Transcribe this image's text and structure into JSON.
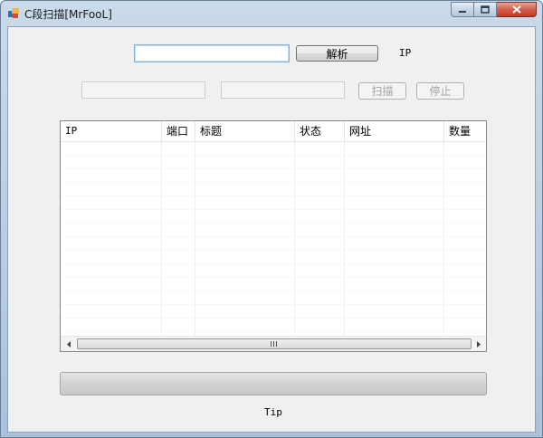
{
  "window": {
    "title": "C段扫描[MrFooL]"
  },
  "top_row": {
    "ip_input_value": "",
    "parse_button_label": "解析",
    "ip_label": "IP"
  },
  "second_row": {
    "start_input_value": "",
    "end_input_value": "",
    "scan_button_label": "扫描",
    "stop_button_label": "停止"
  },
  "results_table": {
    "columns": [
      "IP",
      "端口",
      "标题",
      "状态",
      "网址",
      "数量"
    ],
    "rows": []
  },
  "progress": {
    "value": 0
  },
  "status": {
    "tip": "Tip"
  }
}
